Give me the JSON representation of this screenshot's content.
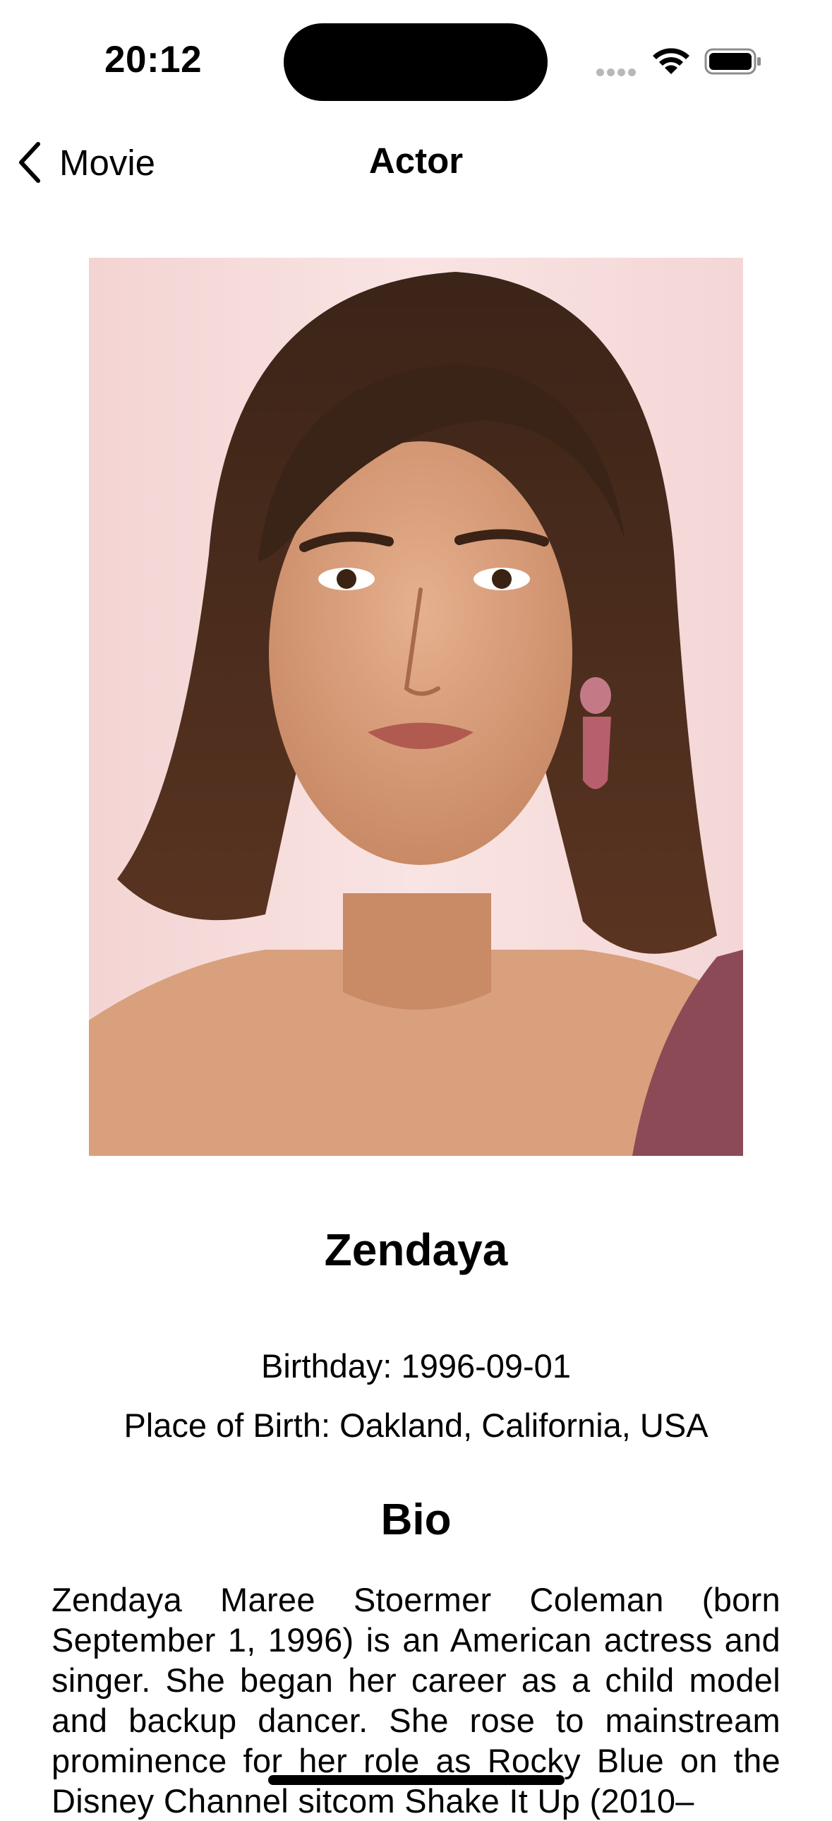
{
  "status_bar": {
    "time": "20:12"
  },
  "nav": {
    "back_label": "Movie",
    "title": "Actor"
  },
  "actor": {
    "photo_icon": "actor-portrait-photo",
    "name": "Zendaya",
    "birthday": "Birthday: 1996-09-01",
    "place_of_birth": "Place of Birth: Oakland, California, USA"
  },
  "bio": {
    "heading": "Bio",
    "text": "Zendaya Maree Stoermer Coleman (born September 1, 1996) is an American actress and singer. She began her career as a child model and backup dancer. She rose to mainstream prominence for her role as Rocky Blue on the Disney Channel sitcom Shake It Up (2010–"
  },
  "colors": {
    "background": "#ffffff",
    "text": "#000000",
    "photo_backdrop": "#f6dcdc"
  }
}
